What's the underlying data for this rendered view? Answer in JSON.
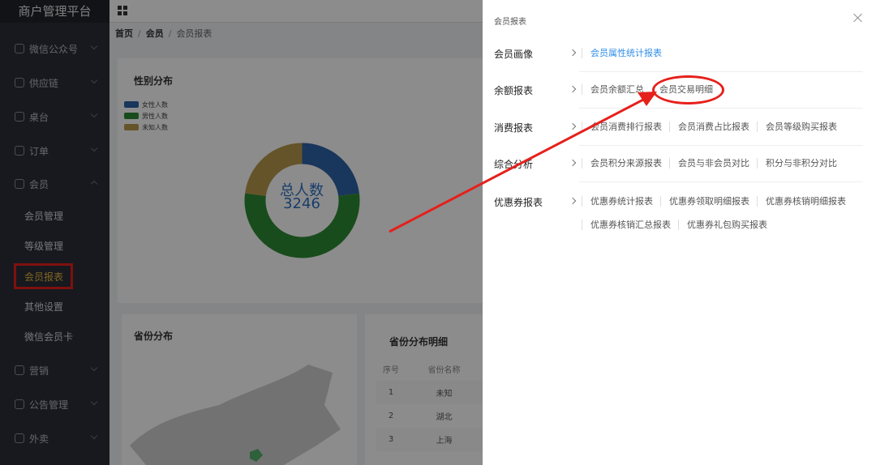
{
  "app": {
    "title": "商户管理平台"
  },
  "sidebar": {
    "items": [
      {
        "label": "微信公众号",
        "icon": "wechat-icon"
      },
      {
        "label": "供应链",
        "icon": "truck-icon"
      },
      {
        "label": "桌台",
        "icon": "table-icon"
      },
      {
        "label": "订单",
        "icon": "order-icon"
      },
      {
        "label": "会员",
        "icon": "star-icon"
      },
      {
        "label": "营销",
        "icon": "gift-icon"
      },
      {
        "label": "公告管理",
        "icon": "bell-icon"
      },
      {
        "label": "外卖",
        "icon": "bike-icon"
      }
    ],
    "sub_items": [
      {
        "label": "会员管理"
      },
      {
        "label": "等级管理"
      },
      {
        "label": "会员报表"
      },
      {
        "label": "其他设置"
      },
      {
        "label": "微信会员卡"
      }
    ]
  },
  "breadcrumb": {
    "home": "首页",
    "section": "会员",
    "current": "会员报表"
  },
  "gender_card": {
    "title": "性别分布",
    "center_label": "总人数",
    "center_value": "3246"
  },
  "chart_data": {
    "type": "pie",
    "title": "性别分布",
    "series": [
      {
        "name": "女性人数",
        "value": 0.23,
        "color": "#2f63a8"
      },
      {
        "name": "男性人数",
        "value": 0.54,
        "color": "#2e8a34"
      },
      {
        "name": "未知人数",
        "value": 0.23,
        "color": "#b89a4e"
      }
    ],
    "total_label": "总人数",
    "total": 3246,
    "legend_position": "top-left"
  },
  "province_card": {
    "title": "省份分布"
  },
  "province_detail": {
    "title": "省份分布明细",
    "headers": [
      "序号",
      "省份名称"
    ],
    "rows": [
      [
        "1",
        "未知"
      ],
      [
        "2",
        "湖北"
      ],
      [
        "3",
        "上海"
      ]
    ]
  },
  "drawer": {
    "title": "会员报表",
    "groups": [
      {
        "category": "会员画像",
        "links": [
          "会员属性统计报表"
        ]
      },
      {
        "category": "余额报表",
        "links": [
          "会员余额汇总",
          "会员交易明细"
        ]
      },
      {
        "category": "消费报表",
        "links": [
          "会员消费排行报表",
          "会员消费占比报表",
          "会员等级购买报表"
        ]
      },
      {
        "category": "综合分析",
        "links": [
          "会员积分来源报表",
          "会员与非会员对比",
          "积分与非积分对比"
        ]
      },
      {
        "category": "优惠券报表",
        "links": [
          "优惠券统计报表",
          "优惠券领取明细报表",
          "优惠券核销明细报表",
          "优惠券核销汇总报表",
          "优惠券礼包购买报表"
        ]
      }
    ]
  },
  "colors": {
    "accent_blue": "#2f8ee8",
    "highlight_red": "#e6201b",
    "active_menu": "#e8b73d"
  }
}
